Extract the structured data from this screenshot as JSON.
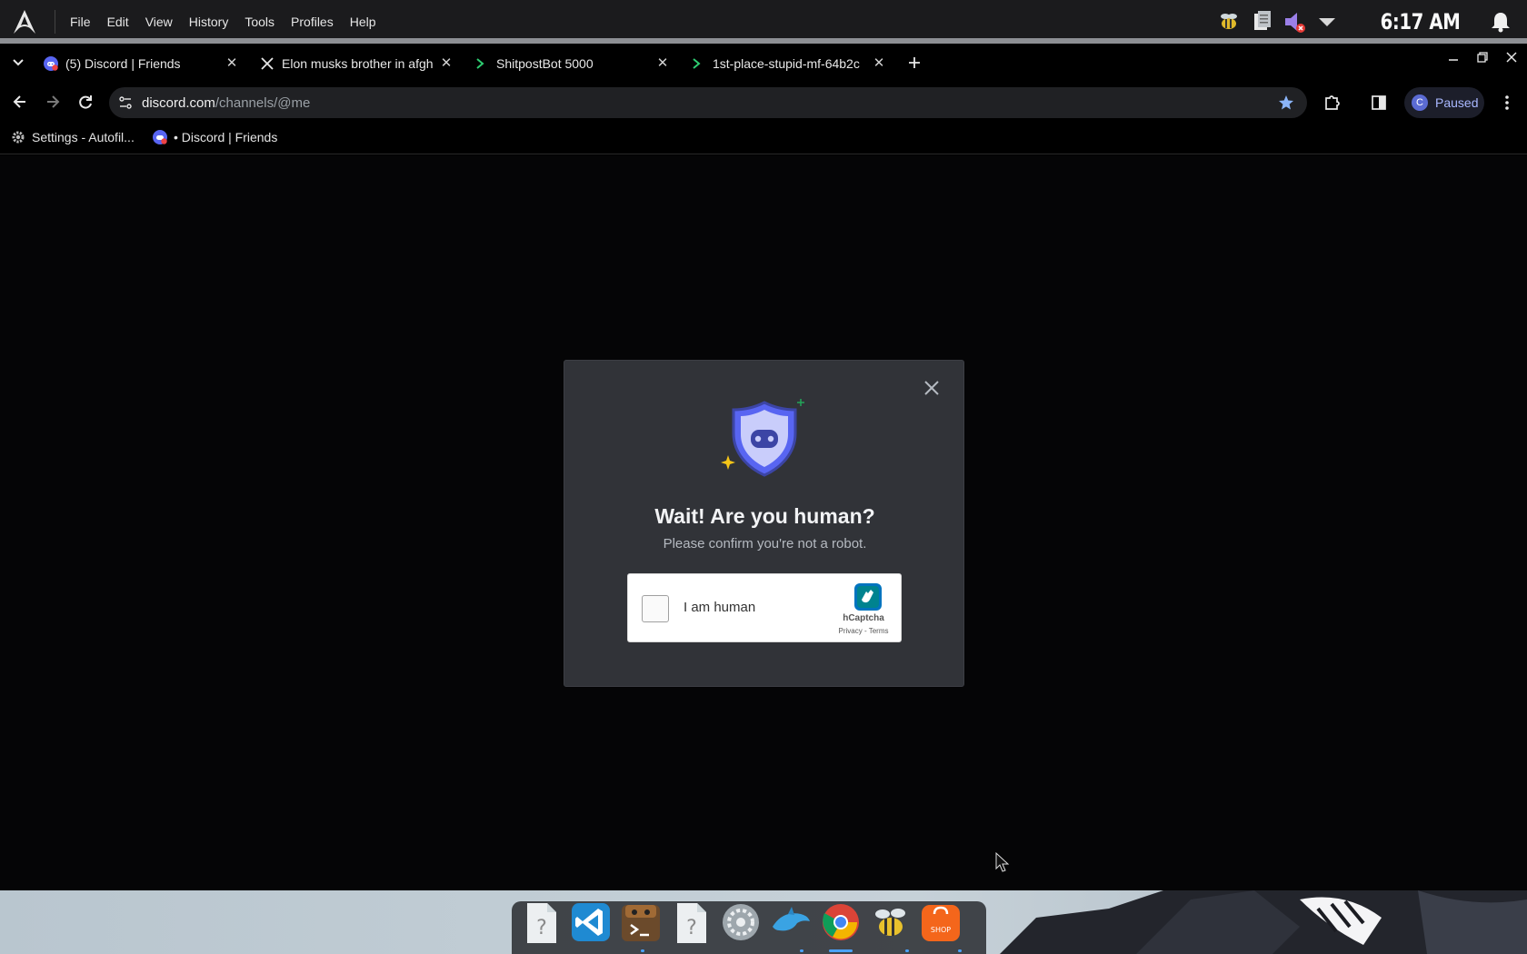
{
  "system_bar": {
    "menu": [
      "File",
      "Edit",
      "View",
      "History",
      "Tools",
      "Profiles",
      "Help"
    ],
    "clock": "6:17 AM"
  },
  "tabs": [
    {
      "title": "(5) Discord | Friends",
      "favicon": "discord-icon",
      "active": true
    },
    {
      "title": "Elon musks brother in afgh",
      "favicon": "x-icon"
    },
    {
      "title": "ShitpostBot 5000",
      "favicon": "terminal-icon"
    },
    {
      "title": "1st-place-stupid-mf-64b2c",
      "favicon": "terminal-icon"
    }
  ],
  "address_bar": {
    "domain": "discord.com",
    "path": "/channels/@me"
  },
  "profile": {
    "initial": "C",
    "status": "Paused"
  },
  "bookmarks": [
    {
      "label": "Settings - Autofil...",
      "icon": "gear-icon"
    },
    {
      "label": "• Discord | Friends",
      "icon": "discord-icon"
    }
  ],
  "modal": {
    "title": "Wait! Are you human?",
    "subtitle": "Please confirm you're not a robot."
  },
  "hcaptcha": {
    "checkbox_label": "I am human",
    "brand": "hCaptcha",
    "links": "Privacy - Terms"
  },
  "dock": {
    "items": [
      "unknown-file-icon",
      "vscode-icon",
      "terminal-app-icon",
      "unknown-file-icon",
      "settings-icon",
      "dolphin-icon",
      "chrome-icon",
      "bee-icon",
      "shop-icon"
    ],
    "shop_label": "SHOP"
  },
  "colors": {
    "modal_bg": "#313338",
    "discord_blurple": "#5865f2",
    "bookmark_star": "#8ab4f8"
  }
}
